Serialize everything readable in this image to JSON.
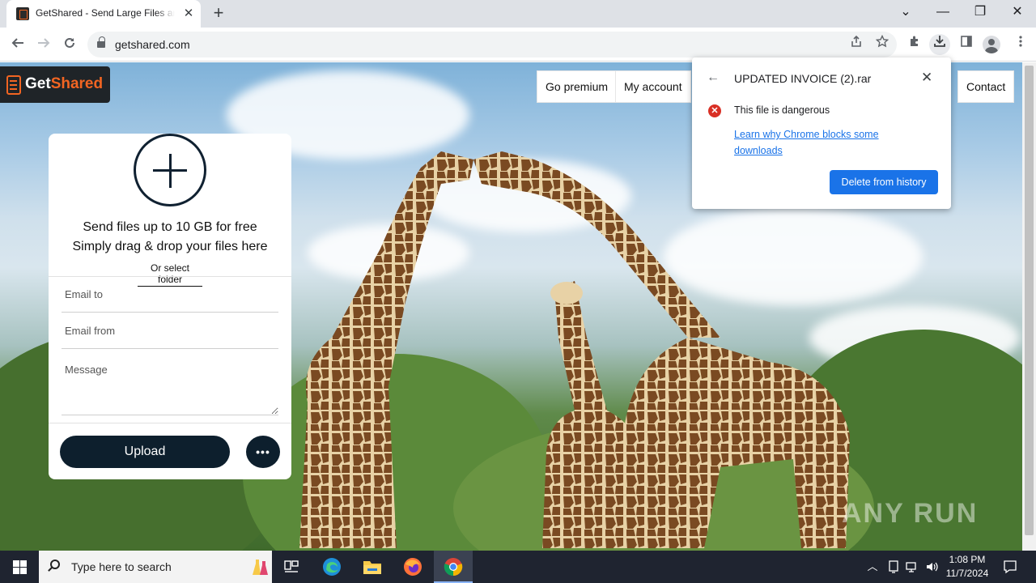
{
  "browser": {
    "tab_title": "GetShared - Send Large Files and Folders",
    "tab_close": "✕",
    "new_tab": "+",
    "url": "getshared.com",
    "window_controls": {
      "chevron": "⌄",
      "minimize": "—",
      "restore": "❐",
      "close": "✕"
    },
    "toolbar_icons": [
      "back-arrow-icon",
      "forward-arrow-icon",
      "reload-icon",
      "lock-icon",
      "share-icon",
      "star-icon",
      "extensions-icon",
      "download-icon",
      "side-panel-icon",
      "profile-icon",
      "kebab-menu-icon"
    ]
  },
  "site": {
    "logo_get": "Get",
    "logo_shared": "Shared",
    "nav": {
      "go_premium": "Go premium",
      "my_account": "My account",
      "contact": "Contact"
    },
    "upload_card": {
      "line1": "Send files up to 10 GB for free",
      "line2": "Simply drag & drop your files here",
      "select_folder": "Or select folder",
      "email_to_placeholder": "Email to",
      "email_from_placeholder": "Email from",
      "message_placeholder": "Message",
      "upload_button": "Upload",
      "more_button": "•••"
    },
    "watermark": "ANY RUN"
  },
  "download_bubble": {
    "back": "←",
    "filename": "UPDATED INVOICE (2).rar",
    "close": "✕",
    "danger_glyph": "✕",
    "warning": "This file is dangerous",
    "learn_link": "Learn why Chrome blocks some downloads",
    "delete_button": "Delete from history"
  },
  "taskbar": {
    "search_placeholder": "Type here to search",
    "time": "1:08 PM",
    "date": "11/7/2024",
    "apps": [
      "task-view-icon",
      "edge-icon",
      "file-explorer-icon",
      "firefox-icon",
      "chrome-icon"
    ]
  },
  "colors": {
    "brand_orange": "#f26522",
    "card_navy": "#0d1f2d",
    "chrome_blue": "#1a73e8",
    "danger_red": "#d93025"
  }
}
